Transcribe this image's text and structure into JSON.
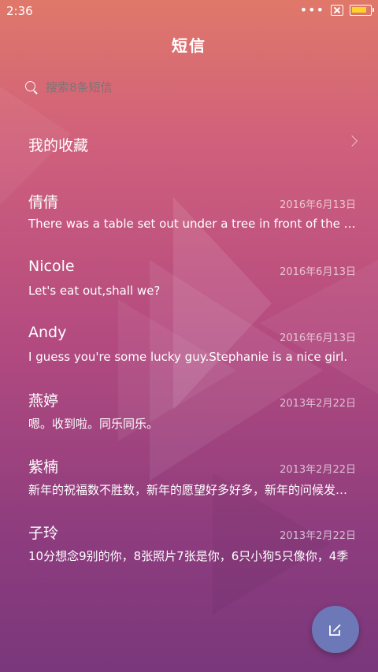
{
  "status_bar": {
    "time": "2:36",
    "dots": "•••",
    "battery_level": 0.85,
    "battery_color": "#ffd52a"
  },
  "header": {
    "title": "短信"
  },
  "search": {
    "placeholder": "搜索8条短信"
  },
  "favorites": {
    "label": "我的收藏"
  },
  "messages": [
    {
      "name": "倩倩",
      "date": "2016年6月13日",
      "preview": "There was a table set out under a tree in front of the house"
    },
    {
      "name": "Nicole",
      "date": "2016年6月13日",
      "preview": "Let's eat out,shall we?"
    },
    {
      "name": "Andy",
      "date": "2016年6月13日",
      "preview": "I guess you're some lucky guy.Stephanie is a nice girl."
    },
    {
      "name": "燕婷",
      "date": "2013年2月22日",
      "preview": "嗯。收到啦。同乐同乐。"
    },
    {
      "name": "紫楠",
      "date": "2013年2月22日",
      "preview": "新年的祝福数不胜数，新年的愿望好多好多，新年的问候发给你"
    },
    {
      "name": "子玲",
      "date": "2013年2月22日",
      "preview": "10分想念9别的你，8张照片7张是你，6只小狗5只像你，4季"
    }
  ],
  "fab": {
    "icon": "compose-icon",
    "color": "#6d78b8"
  }
}
